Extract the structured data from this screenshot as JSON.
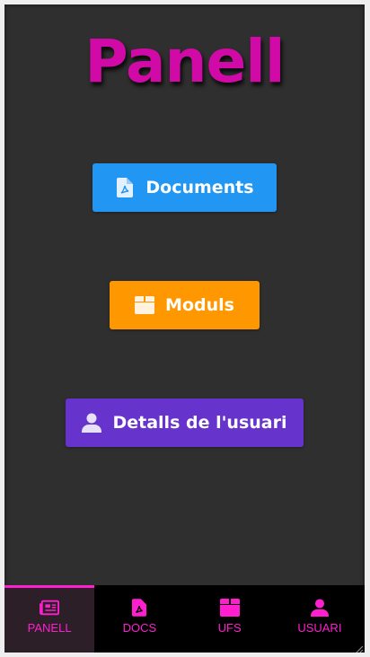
{
  "header": {
    "title": "Panell"
  },
  "buttons": {
    "documents": {
      "label": "Documents",
      "icon": "file-pdf-icon",
      "color": "#2196f3"
    },
    "modules": {
      "label": "Moduls",
      "icon": "box-icon",
      "color": "#ff9800"
    },
    "user_details": {
      "label": "Detalls de l'usuari",
      "icon": "user-icon",
      "color": "#6633cc"
    }
  },
  "bottom_nav": {
    "active_color": "#ff1fcf",
    "items": [
      {
        "label": "PANELL",
        "icon": "newspaper-icon",
        "active": true
      },
      {
        "label": "DOCS",
        "icon": "file-pdf-icon",
        "active": false
      },
      {
        "label": "UFS",
        "icon": "box-icon",
        "active": false
      },
      {
        "label": "USUARI",
        "icon": "user-icon",
        "active": false
      }
    ]
  },
  "theme": {
    "background": "#2f2f2f",
    "title_color": "#d10aa7"
  }
}
